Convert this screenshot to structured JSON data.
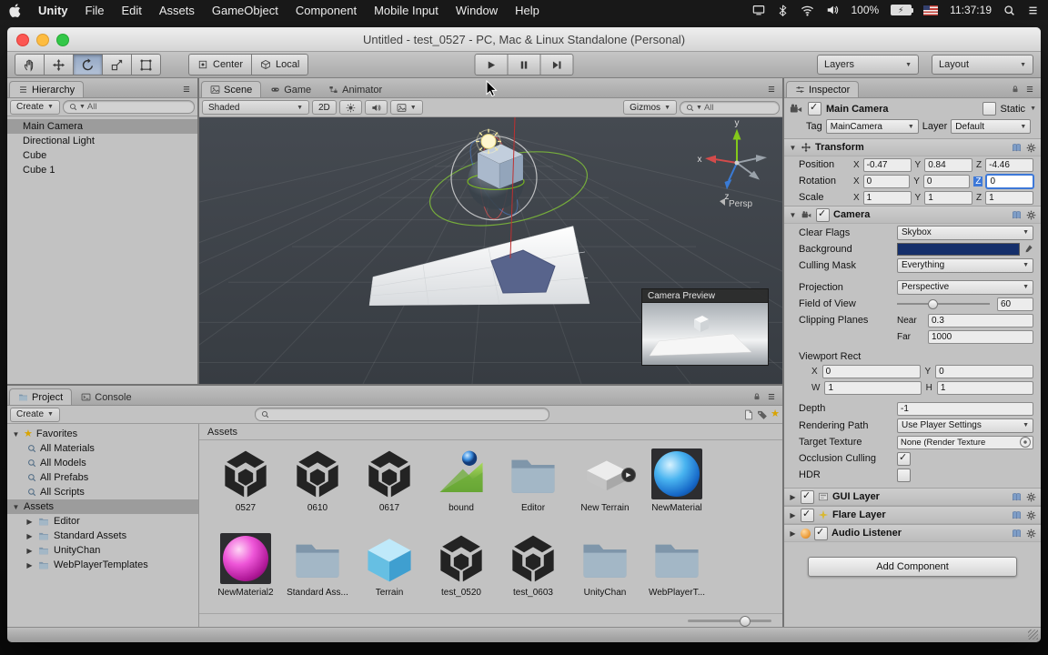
{
  "colors": {
    "selection": "#9c9c9c",
    "focus_blue": "#3d78d8",
    "camera_swatch": "#152f6b",
    "material_blue": "#2a9fe8",
    "material_magenta": "#d83fc8"
  },
  "menubar": {
    "app_name": "Unity",
    "menus": [
      "File",
      "Edit",
      "Assets",
      "GameObject",
      "Component",
      "Mobile Input",
      "Window",
      "Help"
    ],
    "status": {
      "battery": "100%",
      "time": "11:37:19"
    }
  },
  "window": {
    "title": "Untitled - test_0527 - PC, Mac & Linux Standalone (Personal)"
  },
  "toolbar": {
    "pivot": "Center",
    "space": "Local",
    "layers": "Layers",
    "layout": "Layout"
  },
  "hierarchy": {
    "tab": "Hierarchy",
    "create": "Create",
    "search_placeholder": "All",
    "items": [
      {
        "label": "Main Camera",
        "selected": true
      },
      {
        "label": "Directional Light",
        "selected": false
      },
      {
        "label": "Cube",
        "selected": false
      },
      {
        "label": "Cube 1",
        "selected": false
      }
    ]
  },
  "scene": {
    "tabs": [
      "Scene",
      "Game",
      "Animator"
    ],
    "draw_mode": "Shaded",
    "toggle_2d": "2D",
    "gizmos": "Gizmos",
    "search_placeholder": "All",
    "projection_label": "Persp",
    "camera_preview": "Camera Preview",
    "axes": {
      "x": "x",
      "y": "y",
      "z": "z"
    }
  },
  "project": {
    "tabs": [
      "Project",
      "Console"
    ],
    "create": "Create",
    "favorites": {
      "label": "Favorites",
      "items": [
        "All Materials",
        "All Models",
        "All Prefabs",
        "All Scripts"
      ]
    },
    "root": "Assets",
    "folders": [
      "Editor",
      "Standard Assets",
      "UnityChan",
      "WebPlayerTemplates"
    ],
    "breadcrumb": "Assets",
    "items": [
      {
        "label": "0527",
        "type": "unity"
      },
      {
        "label": "0610",
        "type": "unity"
      },
      {
        "label": "0617",
        "type": "unity"
      },
      {
        "label": "bound",
        "type": "scene"
      },
      {
        "label": "Editor",
        "type": "folder"
      },
      {
        "label": "New Terrain",
        "type": "terrain-asset"
      },
      {
        "label": "NewMaterial",
        "type": "material-blue"
      },
      {
        "label": "NewMaterial2",
        "type": "material-magenta"
      },
      {
        "label": "Standard Ass...",
        "type": "folder"
      },
      {
        "label": "Terrain",
        "type": "cube"
      },
      {
        "label": "test_0520",
        "type": "unity"
      },
      {
        "label": "test_0603",
        "type": "unity"
      },
      {
        "label": "UnityChan",
        "type": "folder"
      },
      {
        "label": "WebPlayerT...",
        "type": "folder"
      }
    ]
  },
  "inspector": {
    "tab": "Inspector",
    "name": "Main Camera",
    "static_label": "Static",
    "tag_label": "Tag",
    "tag_value": "MainCamera",
    "layer_label": "Layer",
    "layer_value": "Default",
    "axes": {
      "x": "X",
      "y": "Y",
      "z": "Z",
      "w": "W",
      "h": "H"
    },
    "transform": {
      "title": "Transform",
      "rows": [
        {
          "label": "Position",
          "x": "-0.47",
          "y": "0.84",
          "z": "-4.46"
        },
        {
          "label": "Rotation",
          "x": "0",
          "y": "0",
          "z": "0"
        },
        {
          "label": "Scale",
          "x": "1",
          "y": "1",
          "z": "1"
        }
      ]
    },
    "camera": {
      "title": "Camera",
      "clear_flags_label": "Clear Flags",
      "clear_flags": "Skybox",
      "background_label": "Background",
      "culling_mask_label": "Culling Mask",
      "culling_mask": "Everything",
      "projection_label": "Projection",
      "projection": "Perspective",
      "fov_label": "Field of View",
      "fov": "60",
      "clipping_label": "Clipping Planes",
      "near_label": "Near",
      "near": "0.3",
      "far_label": "Far",
      "far": "1000",
      "viewport_label": "Viewport Rect",
      "viewport": {
        "x": "0",
        "y": "0",
        "w": "1",
        "h": "1"
      },
      "depth_label": "Depth",
      "depth": "-1",
      "rendering_path_label": "Rendering Path",
      "rendering_path": "Use Player Settings",
      "target_texture_label": "Target Texture",
      "target_texture": "None (Render Texture",
      "occlusion_label": "Occlusion Culling",
      "hdr_label": "HDR"
    },
    "components": [
      {
        "name": "GUI Layer"
      },
      {
        "name": "Flare Layer"
      },
      {
        "name": "Audio Listener"
      }
    ],
    "add_component": "Add Component"
  }
}
